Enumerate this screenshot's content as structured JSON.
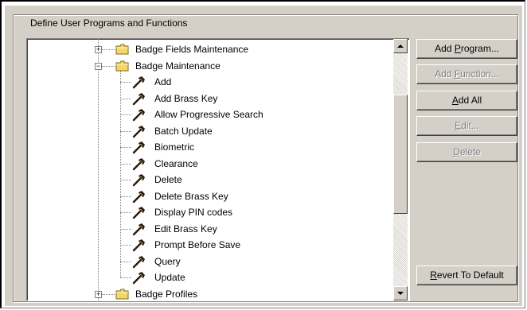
{
  "group": {
    "title": "Define User Programs and Functions"
  },
  "tree": {
    "nodes": [
      {
        "label": "Badge Fields Maintenance",
        "type": "folder",
        "expanded": false,
        "level": 1
      },
      {
        "label": "Badge Maintenance",
        "type": "folder",
        "expanded": true,
        "level": 1
      },
      {
        "label": "Add",
        "type": "function",
        "level": 2
      },
      {
        "label": "Add Brass Key",
        "type": "function",
        "level": 2
      },
      {
        "label": "Allow Progressive Search",
        "type": "function",
        "level": 2
      },
      {
        "label": "Batch Update",
        "type": "function",
        "level": 2
      },
      {
        "label": "Biometric",
        "type": "function",
        "level": 2
      },
      {
        "label": "Clearance",
        "type": "function",
        "level": 2
      },
      {
        "label": "Delete",
        "type": "function",
        "level": 2
      },
      {
        "label": "Delete Brass Key",
        "type": "function",
        "level": 2
      },
      {
        "label": "Display PIN codes",
        "type": "function",
        "level": 2
      },
      {
        "label": "Edit Brass Key",
        "type": "function",
        "level": 2
      },
      {
        "label": "Prompt Before Save",
        "type": "function",
        "level": 2
      },
      {
        "label": "Query",
        "type": "function",
        "level": 2
      },
      {
        "label": "Update",
        "type": "function",
        "level": 2
      },
      {
        "label": "Badge Profiles",
        "type": "folder",
        "expanded": false,
        "level": 1
      }
    ]
  },
  "buttons": {
    "add_program": "Add Program...",
    "add_function": "Add Function...",
    "add_all": "Add All",
    "edit": "Edit...",
    "delete": "Delete",
    "revert": "Revert To Default"
  },
  "icons": {
    "folder": "folder-icon",
    "function": "hammer-icon",
    "expand": "plus-box-icon",
    "collapse": "minus-box-icon"
  },
  "colors": {
    "face": "#d4d0c8",
    "folder": "#f5d66b",
    "hammer": "#2a1a0a",
    "disabled_text": "#808080"
  }
}
